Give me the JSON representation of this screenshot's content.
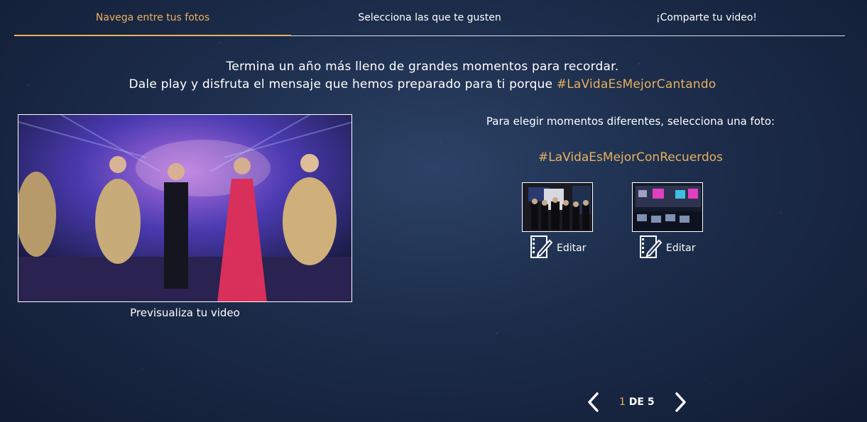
{
  "steps": [
    {
      "label": "Navega entre tus fotos"
    },
    {
      "label": "Selecciona las que te gusten"
    },
    {
      "label": "¡Comparte tu video!"
    }
  ],
  "intro": {
    "line1": "Termina un año más lleno de grandes momentos para recordar.",
    "line2_text": "Dale play y disfruta el mensaje que hemos preparado para ti porque",
    "line2_hashtag": "#LaVidaEsMejorCantando"
  },
  "preview": {
    "caption": "Previsualiza tu video"
  },
  "picker": {
    "label": "Para elegir momentos diferentes, selecciona una foto:",
    "hashtag": "#LaVidaEsMejorConRecuerdos",
    "photos": [
      {
        "edit_label": "Editar"
      },
      {
        "edit_label": "Editar"
      }
    ]
  },
  "pagination": {
    "current": "1",
    "of_text": "DE 5"
  },
  "colors": {
    "accent": "#e8b15e",
    "background": "#1c2c4a"
  }
}
